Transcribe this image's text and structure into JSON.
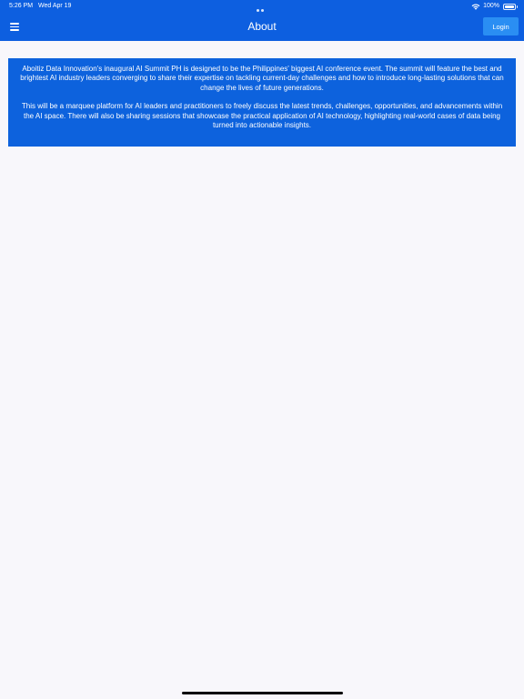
{
  "status_bar": {
    "time": "5:26 PM",
    "date": "Wed Apr 19",
    "battery": "100%"
  },
  "header": {
    "title": "About",
    "login_label": "Login"
  },
  "about": {
    "paragraphs": [
      "Aboitiz Data Innovation's inaugural AI Summit PH is designed to be the Philippines' biggest AI conference event. The summit will feature the best and brightest AI industry leaders converging to share their expertise on tackling current-day challenges and how to introduce long-lasting solutions that can change the lives of future generations.",
      "This will be a marquee platform for AI leaders and practitioners to freely discuss the latest trends, challenges, opportunities, and advancements within the AI space. There will also be sharing sessions that showcase the practical application of AI technology, highlighting real-world cases of data being turned into actionable insights."
    ]
  },
  "colors": {
    "brand_blue": "#0d5fe0",
    "card_blue": "#0d62dd",
    "login_blue": "#2a8ef3",
    "background": "#f8f7fb"
  },
  "icons": [
    "menu-icon",
    "wifi-icon",
    "battery-icon"
  ]
}
